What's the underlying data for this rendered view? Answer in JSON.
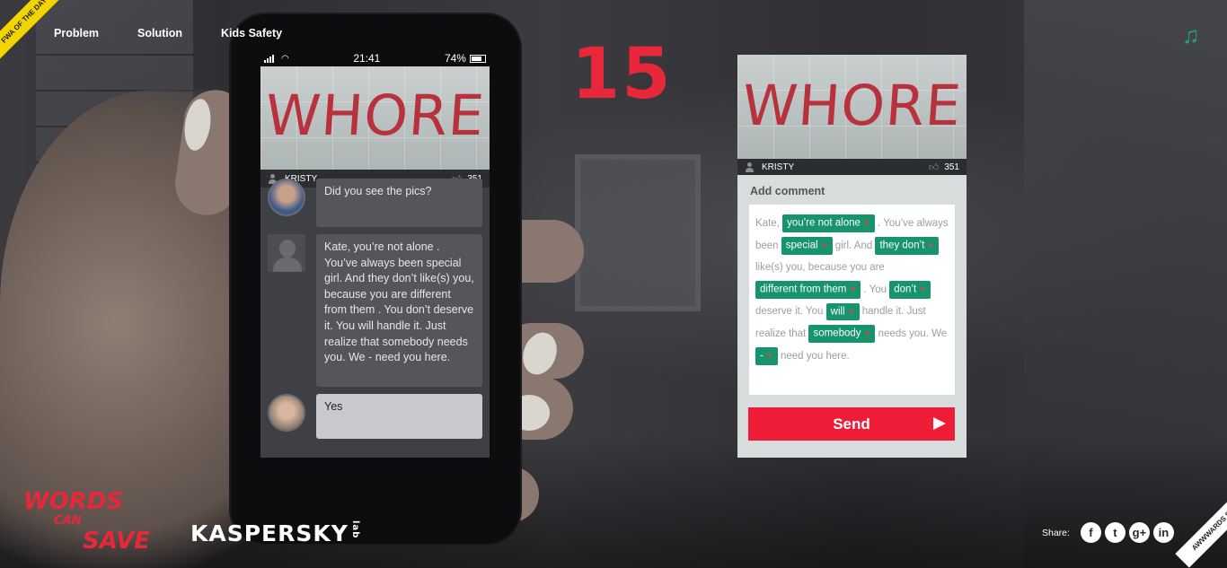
{
  "nav": {
    "items": [
      "Problem",
      "Solution",
      "Kids Safety"
    ],
    "ribbon": "FWA OF THE DAY"
  },
  "music_icon": "music-note-icon",
  "counter": "15",
  "phone": {
    "status": {
      "time": "21:41",
      "battery": "74%"
    },
    "photo_word": "WHORE",
    "author": "KRISTY",
    "likes": "351",
    "messages": [
      {
        "text": "Did you see the pics?",
        "style": "dark"
      },
      {
        "text": "Kate, you’re not alone . You’ve always been special girl. And they don’t like(s) you, because you are different from them . You don’t deserve it. You will handle it. Just realize that somebody needs you. We - need you here.",
        "style": "dark"
      },
      {
        "text": "Yes",
        "style": "light"
      }
    ]
  },
  "card": {
    "photo_word": "WHORE",
    "author": "KRISTY",
    "likes": "351",
    "title": "Add comment",
    "comment": {
      "t1": "Kate, ",
      "c1": "you’re not alone",
      "t2": " . You’ve always been ",
      "c2": "special",
      "t3": " girl. And ",
      "c3": "they don’t",
      "t4": " like(s) you, because you are ",
      "c4": "different from them",
      "t5": " . You ",
      "c5": "don’t",
      "t6": " deserve it. You ",
      "c6": "will",
      "t7": " handle it. Just realize that ",
      "c7": "somebody",
      "t8": " needs you. We ",
      "c8": "-",
      "t9": " need you here."
    },
    "send_label": "Send"
  },
  "footer": {
    "brand_words": "WORDS",
    "brand_can": "CAN",
    "brand_save": "SAVE",
    "kaspersky": "KASPERSKY",
    "kaspersky_lab": "lab",
    "share_label": "Share:",
    "social": [
      "f",
      "t",
      "g+",
      "in"
    ],
    "awwwards": "AWWWARDS SOTD"
  },
  "colors": {
    "accent_red": "#e8283a",
    "tag_green": "#17946e",
    "send_red": "#ef1c38"
  }
}
